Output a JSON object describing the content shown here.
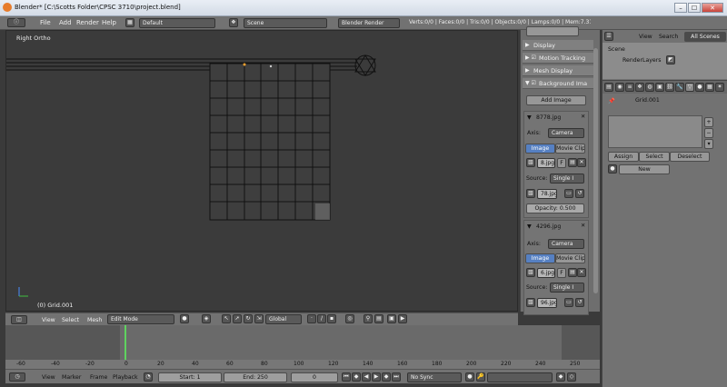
{
  "window": {
    "title": "Blender* [C:\\Scotts Folder\\CPSC 3710\\project.blend]",
    "min_glyph": "–",
    "max_glyph": "☐",
    "close_glyph": "✕"
  },
  "menubar": {
    "items": [
      "File",
      "Add",
      "Render",
      "Help"
    ],
    "layout": "Default",
    "scene": "Scene",
    "engine": "Blender Render",
    "stats": "Verts:0/0 | Faces:0/0 | Tris:0/0 | Objects:0/0 | Lamps:0/0 | Mem:7.31M | Grid.001"
  },
  "viewport": {
    "view_label": "Right Ortho",
    "object_label": "(0) Grid.001"
  },
  "view_header": {
    "items": [
      "View",
      "Select",
      "Mesh"
    ],
    "mode": "Edit Mode",
    "orientation": "Global"
  },
  "npanel": {
    "sections": [
      "Display",
      "Motion Tracking",
      "Mesh Display",
      "Background Ima"
    ],
    "add_image": "Add Image",
    "images": [
      {
        "name": "8778.jpg",
        "axis_label": "Axis:",
        "axis_value": "Camera",
        "tab_image": "Image",
        "tab_movie": "Movie Clip",
        "file": "8.jpg",
        "file_flag": "F",
        "source_label": "Source:",
        "source_value": "Single I",
        "file2": "78.jpg",
        "opacity": "Opacity: 0.500"
      },
      {
        "name": "4296.jpg",
        "axis_label": "Axis:",
        "axis_value": "Camera",
        "tab_image": "Image",
        "tab_movie": "Movie Clip",
        "file": "6.jpg",
        "file_flag": "F",
        "source_label": "Source:",
        "source_value": "Single I",
        "file2": "96.jpg"
      }
    ]
  },
  "outliner": {
    "tabs": [
      "View",
      "Search",
      "All Scenes"
    ],
    "tree": [
      "Scene",
      "RenderLayers"
    ]
  },
  "properties": {
    "object": "Grid.001",
    "buttons": [
      "Assign",
      "Select",
      "Deselect"
    ],
    "new": "New"
  },
  "timeline": {
    "ticks": [
      "-60",
      "-40",
      "-20",
      "0",
      "20",
      "40",
      "60",
      "80",
      "100",
      "120",
      "140",
      "160",
      "180",
      "200",
      "220",
      "240",
      "250"
    ],
    "current_frame": 1
  },
  "timeline_bar": {
    "items": [
      "View",
      "Marker",
      "Frame",
      "Playback"
    ],
    "start": "Start: 1",
    "end": "End: 250",
    "current": "0",
    "sync": "No Sync"
  }
}
